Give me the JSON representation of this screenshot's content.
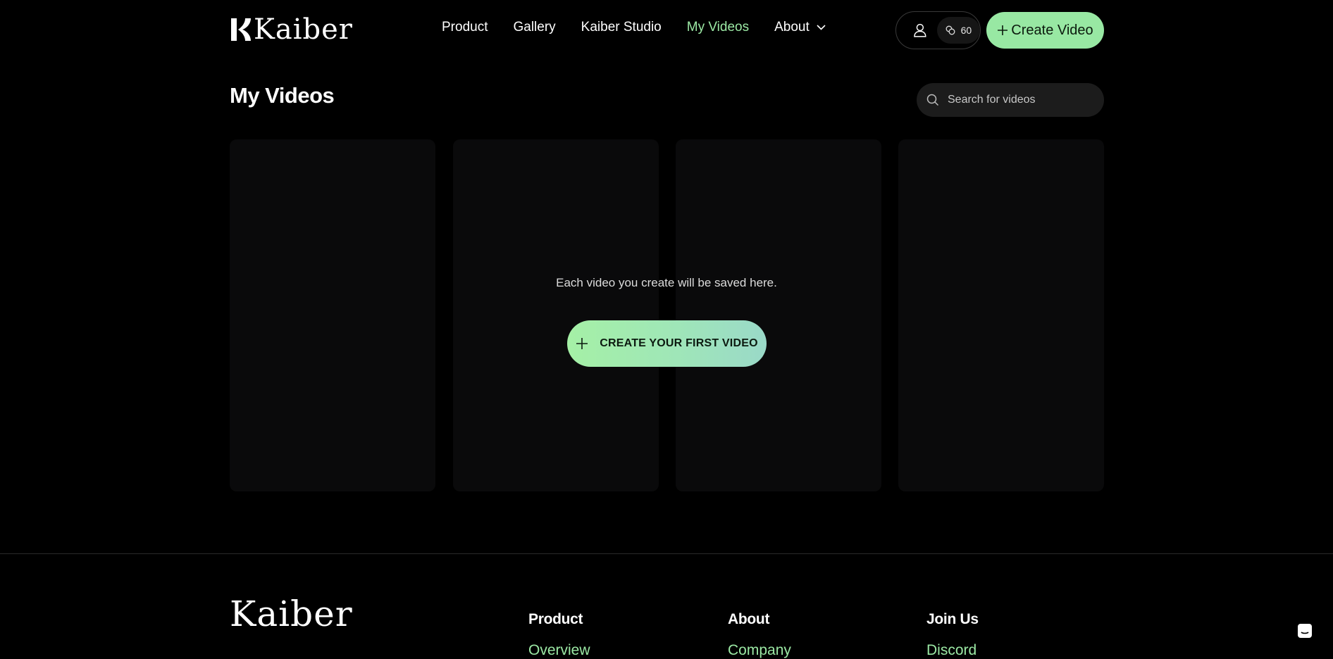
{
  "brand": {
    "name": "Kaiber",
    "accent": "#98e8a3"
  },
  "nav": {
    "items": [
      {
        "label": "Product"
      },
      {
        "label": "Gallery"
      },
      {
        "label": "Kaiber Studio"
      },
      {
        "label": "My Videos",
        "active": true
      },
      {
        "label": "About"
      }
    ]
  },
  "account": {
    "credits": "60",
    "user_icon": "user-icon",
    "credits_icon": "coins-icon"
  },
  "header": {
    "create_label": "Create Video"
  },
  "page": {
    "title": "My Videos"
  },
  "search": {
    "placeholder": "Search for videos",
    "value": ""
  },
  "empty_state": {
    "message": "Each video you create will be saved here.",
    "button_label": "CREATE YOUR FIRST VIDEO"
  },
  "footer": {
    "logo": "Kaiber",
    "columns": [
      {
        "title": "Product",
        "links": [
          "Overview"
        ]
      },
      {
        "title": "About",
        "links": [
          "Company"
        ]
      },
      {
        "title": "Join Us",
        "links": [
          "Discord"
        ]
      }
    ]
  }
}
